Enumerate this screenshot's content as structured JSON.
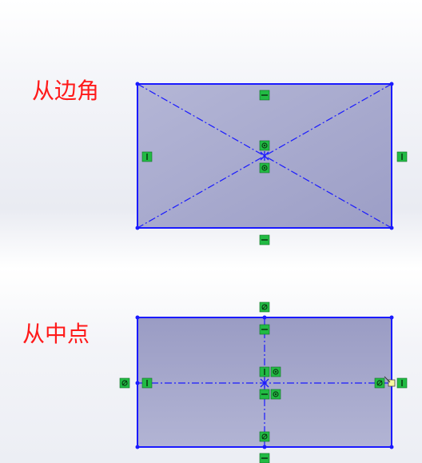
{
  "labels": {
    "corner_method": "从边角",
    "center_method": "从中点"
  },
  "colors": {
    "label_text": "#ff1a1a",
    "sketch_line": "#1a1aff",
    "rect_fill": "#a6a8cc",
    "relation_icon": "#22bb44"
  },
  "relation_icons": {
    "horizontal": "horizontal-relation-icon",
    "vertical": "vertical-relation-icon",
    "coincident": "coincident-relation-icon",
    "midpoint": "midpoint-relation-icon"
  }
}
